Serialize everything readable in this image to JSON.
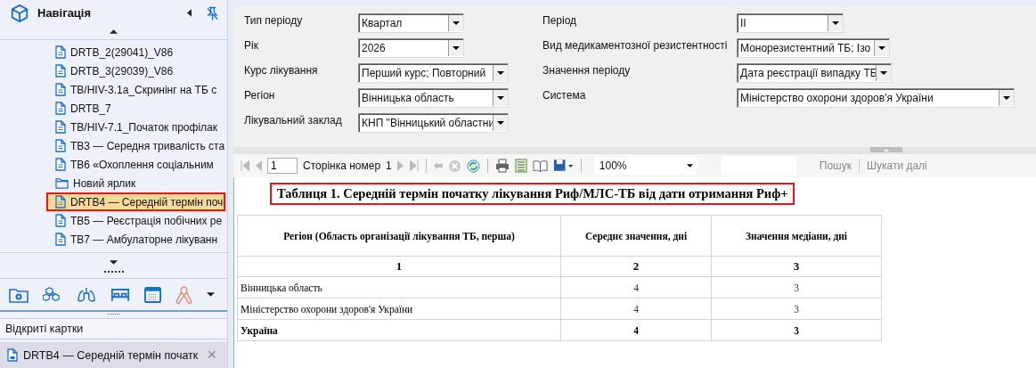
{
  "sidebar": {
    "title": "Навігація",
    "items": [
      {
        "kind": "report",
        "label": "DRTB_2(29041)_V86",
        "selected": false
      },
      {
        "kind": "report",
        "label": "DRTB_3(29039)_V86",
        "selected": false
      },
      {
        "kind": "report",
        "label": "TB/HIV-3.1а_Скринінг на ТБ с",
        "selected": false
      },
      {
        "kind": "report",
        "label": "DRTB_7",
        "selected": false
      },
      {
        "kind": "report",
        "label": "TB/HIV-7.1_Початок профілак",
        "selected": false
      },
      {
        "kind": "report",
        "label": "TB3 — Середня тривалість ста",
        "selected": false
      },
      {
        "kind": "report",
        "label": "TB6 «Охоплення соціальним",
        "selected": false
      },
      {
        "kind": "folder",
        "label": "Новий ярлик",
        "selected": false
      },
      {
        "kind": "report",
        "label": "DRTB4 — Середній термін поч",
        "selected": true
      },
      {
        "kind": "report",
        "label": "TB5 — Реєстрація побічних ре",
        "selected": false
      },
      {
        "kind": "report",
        "label": "TB7 — Амбулаторне лікуванн",
        "selected": false
      }
    ],
    "open_cards": {
      "title": "Відкриті картки",
      "items": [
        {
          "label": "DRTB4 — Середній термін початк",
          "close": "×"
        }
      ]
    }
  },
  "parameters": {
    "left": [
      {
        "label": "Тип періоду",
        "value": "Квартал"
      },
      {
        "label": "Рік",
        "value": "2026"
      },
      {
        "label": "Курс лікування",
        "value": "Перший курс; Повторний"
      },
      {
        "label": "Регіон",
        "value": "Вінницька область"
      },
      {
        "label": "Лікувальний заклад",
        "value": "КНП \"Вінницький областни"
      }
    ],
    "right": [
      {
        "label": "Період",
        "value": "II"
      },
      {
        "label": "Вид медикаментозної резистентності",
        "value": "Монорезистентний ТБ; Ізо"
      },
      {
        "label": "Значення періоду",
        "value": "Дата реєстрації випадку ТБ"
      },
      {
        "label": "Система",
        "value": "Міністерство охорони здоров'я України"
      }
    ]
  },
  "toolbar": {
    "page": "1",
    "page_label": "Сторінка номер",
    "page_count": "1",
    "zoom": "100%",
    "find": "Пошук",
    "find_next": "Шукати далі"
  },
  "report": {
    "title": "Таблиця 1. Середній термін початку лікування Риф/МЛС-ТБ від дати отримання Риф+",
    "columns": [
      "Регіон (Область організації лікування ТБ, перша)",
      "Середнє значення, дні",
      "Значення медіани, дні"
    ],
    "column_numbers": [
      "1",
      "2",
      "3"
    ],
    "rows": [
      {
        "kind": "data",
        "cells": [
          "Вінницька область",
          "4",
          "3"
        ]
      },
      {
        "kind": "data",
        "cells": [
          "Міністерство охорони здоров'я України",
          "4",
          "3"
        ]
      },
      {
        "kind": "total",
        "cells": [
          "Україна",
          "4",
          "3"
        ]
      }
    ]
  }
}
